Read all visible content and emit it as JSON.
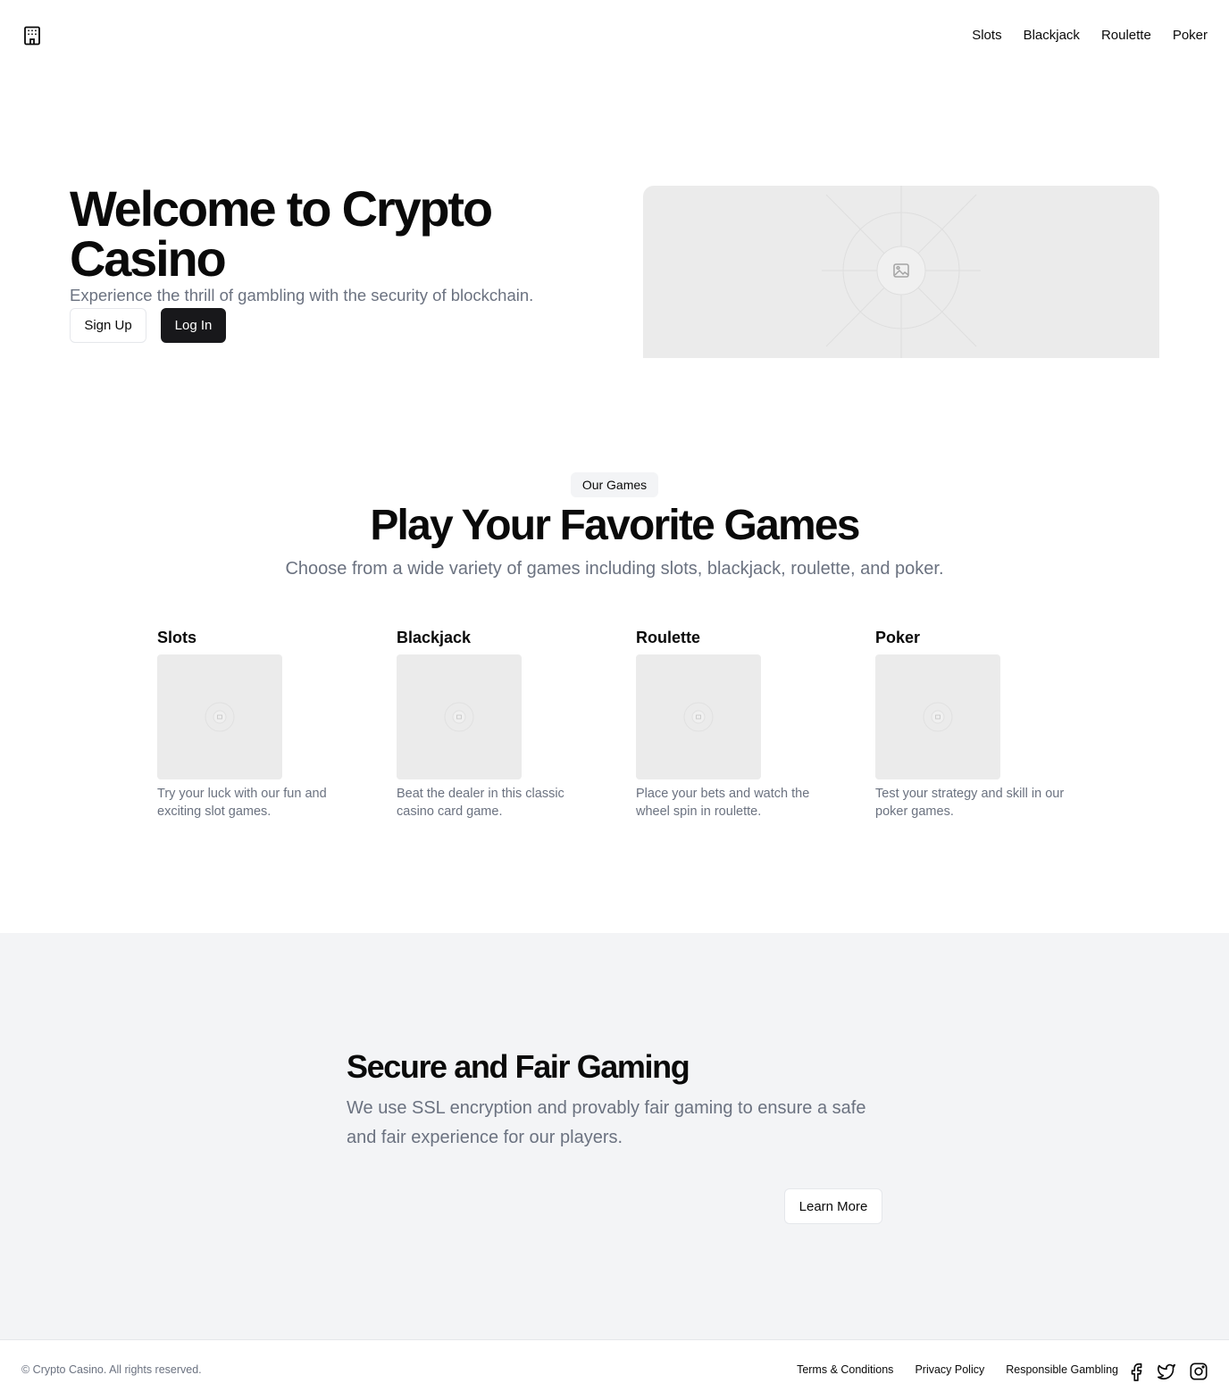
{
  "nav": {
    "logo": "building-icon",
    "items": [
      {
        "label": "Slots"
      },
      {
        "label": "Blackjack"
      },
      {
        "label": "Roulette"
      },
      {
        "label": "Poker"
      }
    ]
  },
  "hero": {
    "title": "Welcome to Crypto Casino",
    "subtitle": "Experience the thrill of gambling with the security of blockchain.",
    "signup_label": "Sign Up",
    "login_label": "Log In",
    "image_icon": "image-placeholder-icon"
  },
  "games": {
    "badge": "Our Games",
    "title": "Play Your Favorite Games",
    "subtitle": "Choose from a wide variety of games including slots, blackjack, roulette, and poker.",
    "cards": [
      {
        "title": "Slots",
        "description": "Try your luck with our fun and exciting slot games."
      },
      {
        "title": "Blackjack",
        "description": "Beat the dealer in this classic casino card game."
      },
      {
        "title": "Roulette",
        "description": "Place your bets and watch the wheel spin in roulette."
      },
      {
        "title": "Poker",
        "description": "Test your strategy and skill in our poker games."
      }
    ]
  },
  "secure": {
    "title": "Secure and Fair Gaming",
    "text": "We use SSL encryption and provably fair gaming to ensure a safe and fair experience for our players.",
    "button_label": "Learn More"
  },
  "footer": {
    "copyright": "© Crypto Casino. All rights reserved.",
    "links": [
      {
        "label": "Terms & Conditions"
      },
      {
        "label": "Privacy Policy"
      },
      {
        "label": "Responsible Gambling"
      }
    ],
    "social": [
      "facebook-icon",
      "twitter-icon",
      "instagram-icon"
    ]
  },
  "colors": {
    "text": "#0a0a0a",
    "muted": "#6b7280",
    "dark_button": "#18181b",
    "section_bg": "#f3f4f6",
    "placeholder_bg": "#ebebeb"
  }
}
